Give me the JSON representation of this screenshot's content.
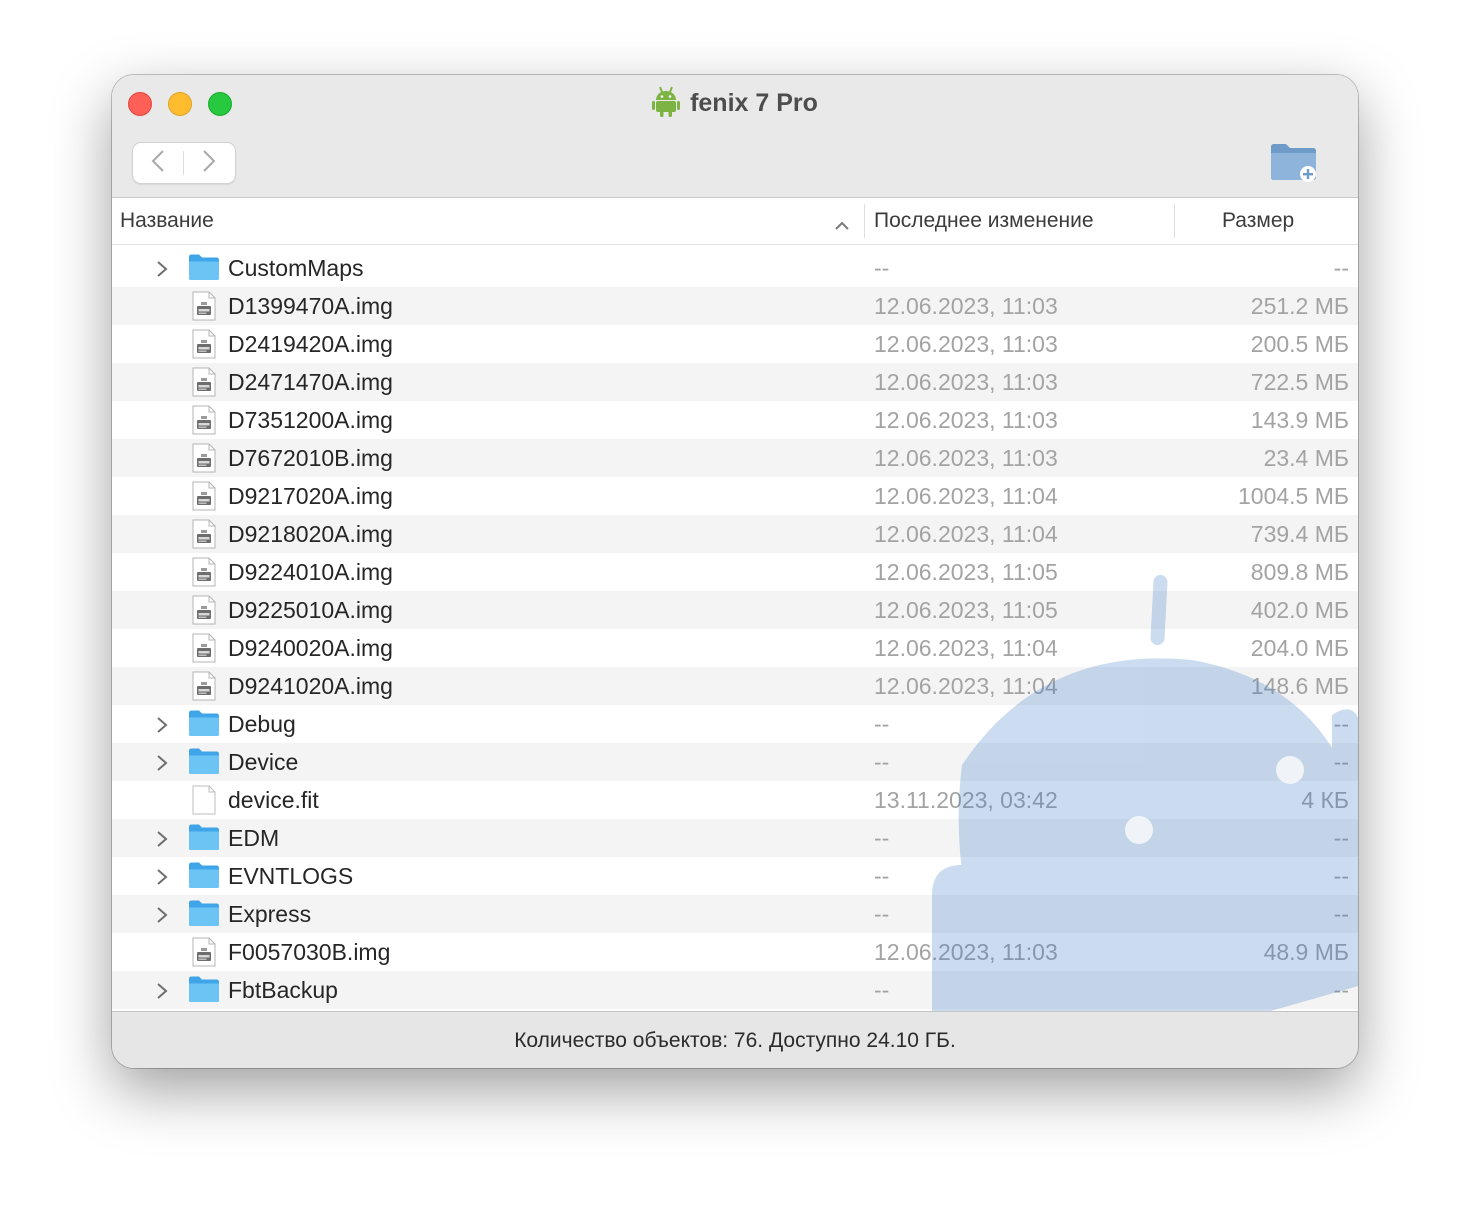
{
  "window": {
    "title": "fenix 7 Pro",
    "title_icon": "android-icon",
    "nav": {
      "back_icon": "chevron-left-icon",
      "forward_icon": "chevron-right-icon"
    },
    "new_folder_icon": "new-folder-icon"
  },
  "columns": {
    "name": "Название",
    "modified": "Последнее изменение",
    "size": "Размер",
    "sort": "ascending"
  },
  "rows": [
    {
      "type": "folder",
      "name": "CustomMaps",
      "modified": "--",
      "size": "--"
    },
    {
      "type": "img",
      "name": "D1399470A.img",
      "modified": "12.06.2023, 11:03",
      "size": "251.2 МБ"
    },
    {
      "type": "img",
      "name": "D2419420A.img",
      "modified": "12.06.2023, 11:03",
      "size": "200.5 МБ"
    },
    {
      "type": "img",
      "name": "D2471470A.img",
      "modified": "12.06.2023, 11:03",
      "size": "722.5 МБ"
    },
    {
      "type": "img",
      "name": "D7351200A.img",
      "modified": "12.06.2023, 11:03",
      "size": "143.9 МБ"
    },
    {
      "type": "img",
      "name": "D7672010B.img",
      "modified": "12.06.2023, 11:03",
      "size": "23.4 МБ"
    },
    {
      "type": "img",
      "name": "D9217020A.img",
      "modified": "12.06.2023, 11:04",
      "size": "1004.5 МБ"
    },
    {
      "type": "img",
      "name": "D9218020A.img",
      "modified": "12.06.2023, 11:04",
      "size": "739.4 МБ"
    },
    {
      "type": "img",
      "name": "D9224010A.img",
      "modified": "12.06.2023, 11:05",
      "size": "809.8 МБ"
    },
    {
      "type": "img",
      "name": "D9225010A.img",
      "modified": "12.06.2023, 11:05",
      "size": "402.0 МБ"
    },
    {
      "type": "img",
      "name": "D9240020A.img",
      "modified": "12.06.2023, 11:04",
      "size": "204.0 МБ"
    },
    {
      "type": "img",
      "name": "D9241020A.img",
      "modified": "12.06.2023, 11:04",
      "size": "148.6 МБ"
    },
    {
      "type": "folder",
      "name": "Debug",
      "modified": "--",
      "size": "--"
    },
    {
      "type": "folder",
      "name": "Device",
      "modified": "--",
      "size": "--"
    },
    {
      "type": "file",
      "name": "device.fit",
      "modified": "13.11.2023, 03:42",
      "size": "4 КБ"
    },
    {
      "type": "folder",
      "name": "EDM",
      "modified": "--",
      "size": "--"
    },
    {
      "type": "folder",
      "name": "EVNTLOGS",
      "modified": "--",
      "size": "--"
    },
    {
      "type": "folder",
      "name": "Express",
      "modified": "--",
      "size": "--"
    },
    {
      "type": "img",
      "name": "F0057030B.img",
      "modified": "12.06.2023, 11:03",
      "size": "48.9 МБ"
    },
    {
      "type": "folder",
      "name": "FbtBackup",
      "modified": "--",
      "size": "--"
    }
  ],
  "status": "Количество объектов: 76. Доступно 24.10 ГБ.",
  "colors": {
    "close": "#fe5f57",
    "minimize": "#febc2e",
    "maximize": "#28c840",
    "folder": "#5ab8f0",
    "android": "#7cb342"
  }
}
